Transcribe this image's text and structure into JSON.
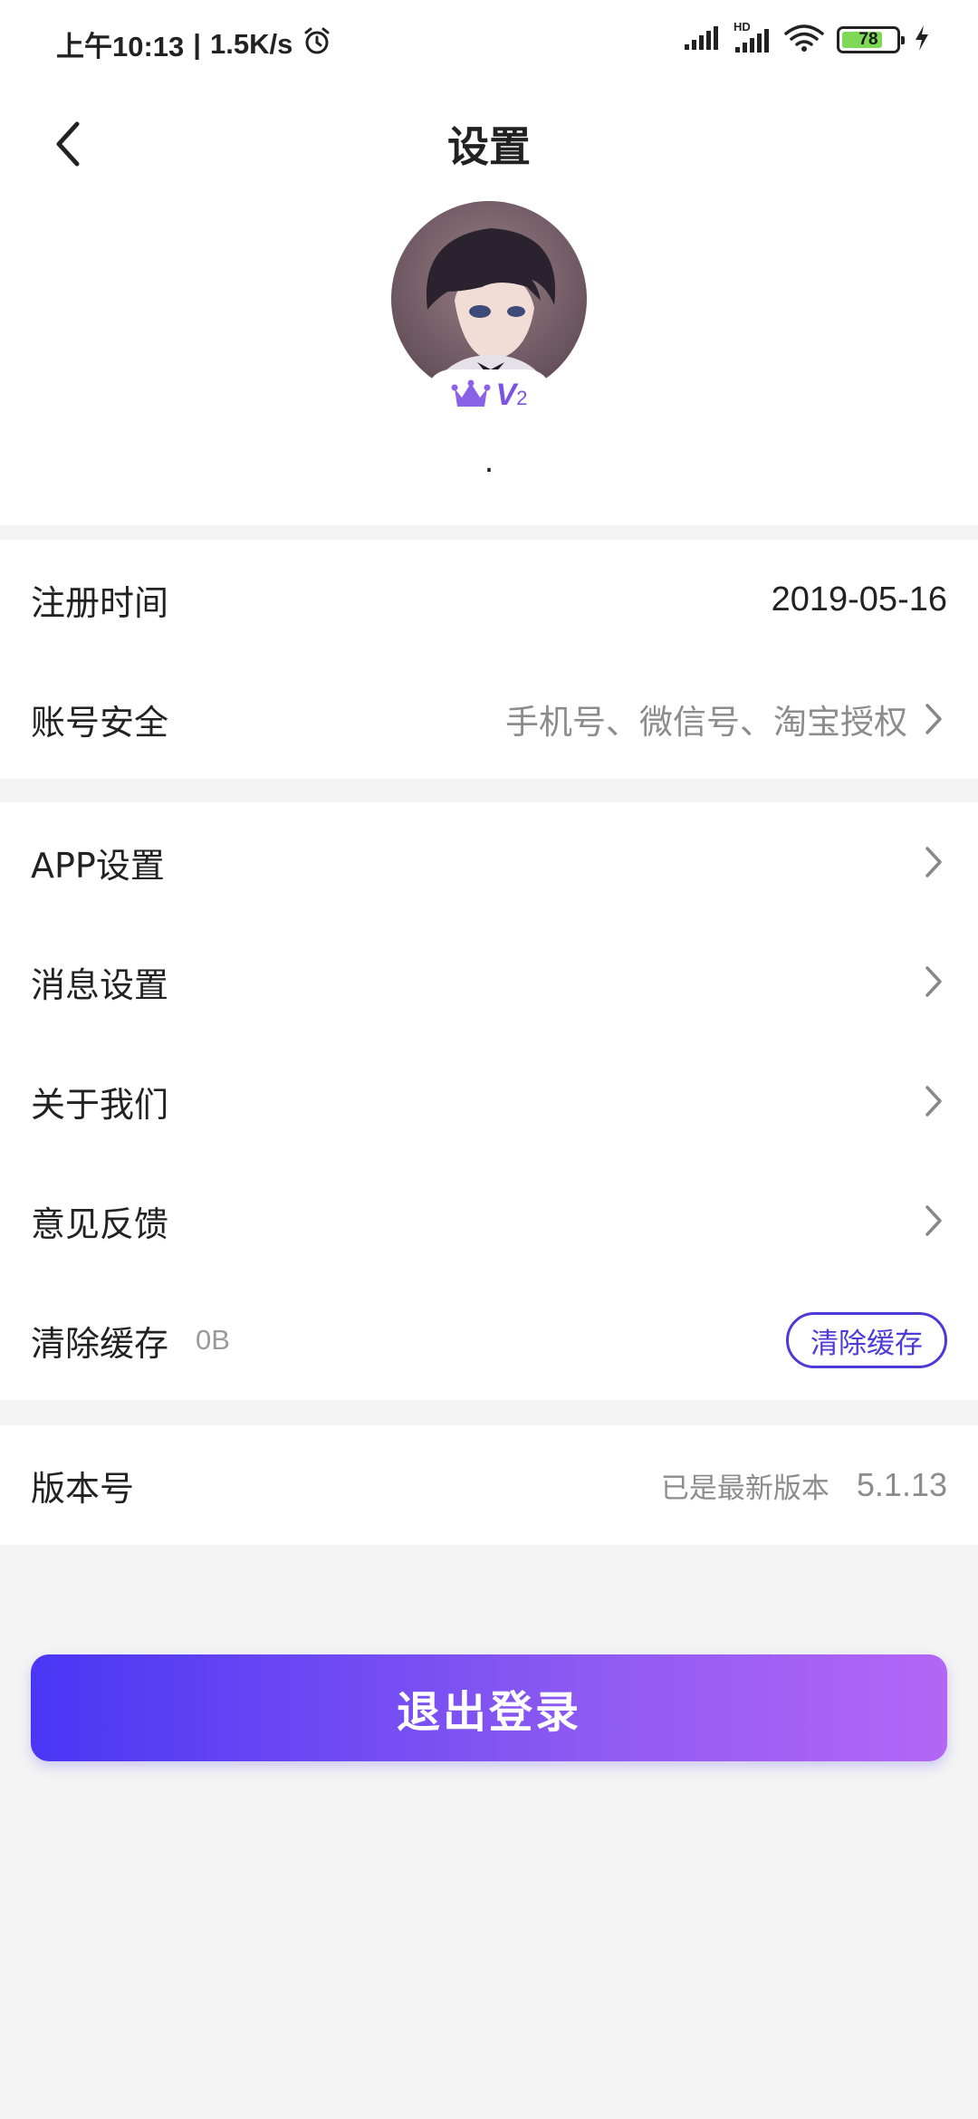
{
  "status_bar": {
    "time": "上午10:13",
    "separator": "|",
    "speed": "1.5K/s",
    "hd_label": "HD",
    "battery": "78",
    "battery_level": 0.78,
    "icons": [
      "alarm-icon",
      "cell-signal-icon",
      "cell-signal-hd-icon",
      "wifi-icon",
      "battery-icon",
      "charging-icon"
    ]
  },
  "header": {
    "title": "设置",
    "back_icon": "chevron-left-icon"
  },
  "profile": {
    "vip_level": "V",
    "vip_level_num": "2",
    "vip_icon": "crown-icon",
    "nickname": "."
  },
  "account": {
    "register_time_label": "注册时间",
    "register_time_value": "2019-05-16",
    "security_label": "账号安全",
    "security_value": "手机号、微信号、淘宝授权"
  },
  "settings": {
    "app_label": "APP设置",
    "message_label": "消息设置",
    "about_label": "关于我们",
    "feedback_label": "意见反馈",
    "cache_label": "清除缓存",
    "cache_size": "0B",
    "cache_button": "清除缓存"
  },
  "version": {
    "label": "版本号",
    "status": "已是最新版本",
    "number": "5.1.13"
  },
  "logout": {
    "label": "退出登录"
  },
  "colors": {
    "accent": "#4c3bd6",
    "gradient_start": "#4a36f5",
    "gradient_end": "#b466f6",
    "vip_purple": "#7b52e6",
    "page_bg": "#f4f4f4"
  }
}
